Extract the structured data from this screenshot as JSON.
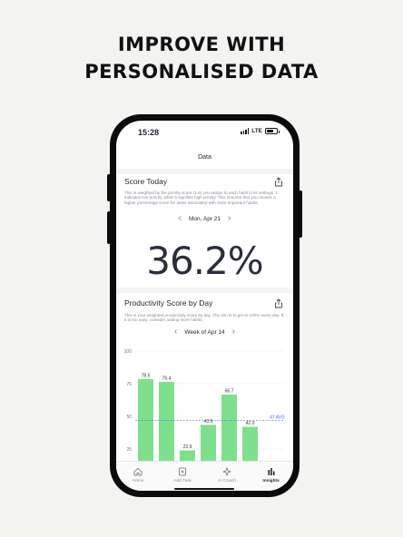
{
  "headline": [
    "IMPROVE WITH",
    "PERSONALISED DATA"
  ],
  "status": {
    "time": "15:28",
    "network": "LTE"
  },
  "nav": {
    "title": "Data"
  },
  "score_today": {
    "title": "Score Today",
    "description": "This is weighted by the priority score (1-5) you assign to each habit in its settings. 1 indicates low priority, while 5 signifies high priority. This ensures that you receive a higher percentage score for tasks associated with more important habits.",
    "date": "Mon, Apr 21",
    "score": "36.2%"
  },
  "productivity": {
    "title": "Productivity Score by Day",
    "description": "This is your weighted productivity score by day. The aim is to get to 100% every day. If it is too easy, consider adding more habits.",
    "week": "Week of Apr 14"
  },
  "chart_data": {
    "type": "bar",
    "title": "",
    "values": [
      78.5,
      76.4,
      23.9,
      43.5,
      66.7,
      42.0
    ],
    "value_labels": [
      "78.5",
      "76.4",
      "23.9",
      "43.5",
      "66.7",
      "42.0"
    ],
    "yticks": [
      "100",
      "75",
      "50",
      "25"
    ],
    "ylim": [
      0,
      100
    ],
    "average": 47,
    "average_label": "47 AVG",
    "bar_color": "#7ee08c",
    "average_color": "#5b6ee8",
    "grid": true
  },
  "tabs": [
    {
      "label": "Home",
      "icon": "home-icon"
    },
    {
      "label": "Add Task",
      "icon": "add-task-icon"
    },
    {
      "label": "AI Coach",
      "icon": "sparkle-icon"
    },
    {
      "label": "Insights",
      "icon": "insights-icon"
    }
  ],
  "active_tab": "Insights"
}
